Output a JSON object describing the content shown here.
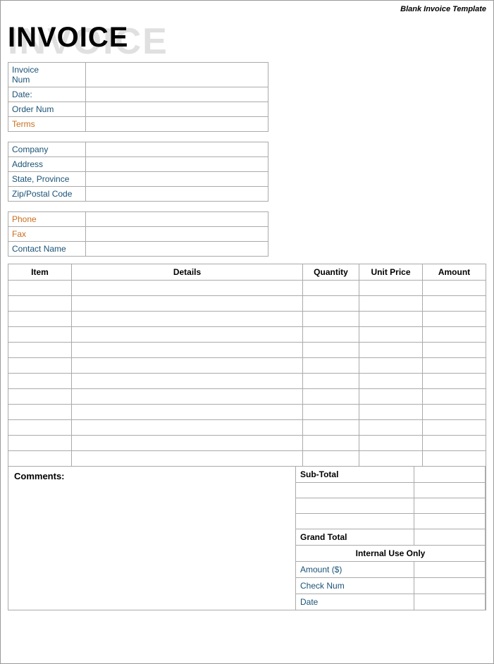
{
  "page": {
    "template_label": "Blank Invoice Template",
    "watermark": "INVOICE",
    "title": "INVOICE"
  },
  "info_section1": {
    "rows": [
      {
        "label": "Invoice Num",
        "label_color": "blue",
        "value": ""
      },
      {
        "label": "Date:",
        "label_color": "blue",
        "value": ""
      },
      {
        "label": "Order Num",
        "label_color": "blue",
        "value": ""
      },
      {
        "label": "Terms",
        "label_color": "orange",
        "value": ""
      }
    ]
  },
  "info_section2": {
    "rows": [
      {
        "label": "Company",
        "label_color": "blue",
        "value": ""
      },
      {
        "label": "Address",
        "label_color": "blue",
        "value": ""
      },
      {
        "label": "State, Province",
        "label_color": "blue",
        "value": ""
      },
      {
        "label": "Zip/Postal Code",
        "label_color": "blue",
        "value": ""
      }
    ]
  },
  "info_section3": {
    "rows": [
      {
        "label": "Phone",
        "label_color": "orange",
        "value": ""
      },
      {
        "label": "Fax",
        "label_color": "orange",
        "value": ""
      },
      {
        "label": "Contact Name",
        "label_color": "blue",
        "value": ""
      }
    ]
  },
  "table": {
    "headers": {
      "item": "Item",
      "details": "Details",
      "quantity": "Quantity",
      "unit_price": "Unit Price",
      "amount": "Amount"
    },
    "rows": 12
  },
  "comments": {
    "label": "Comments:"
  },
  "totals": {
    "subtotal_label": "Sub-Total",
    "grand_total_label": "Grand Total",
    "internal_use_label": "Internal Use Only",
    "fields": [
      {
        "label": "Amount ($)",
        "label_color": "blue"
      },
      {
        "label": "Check Num",
        "label_color": "blue"
      },
      {
        "label": "Date",
        "label_color": "blue"
      }
    ]
  }
}
